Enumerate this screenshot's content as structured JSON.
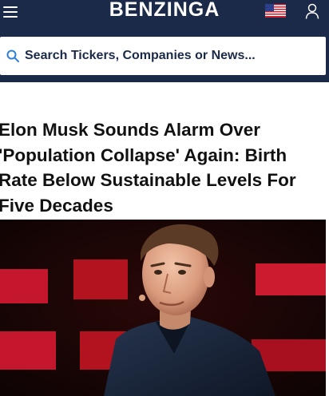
{
  "header": {
    "logo_text": "BENZINGA",
    "menu_icon": "hamburger-menu-icon",
    "flag_icon": "us-flag-icon",
    "user_icon": "user-account-icon",
    "background_color": "#1b2a48"
  },
  "search": {
    "icon": "search-icon",
    "placeholder": "Search Tickers, Companies or News...",
    "icon_color": "#2f7fd9"
  },
  "article": {
    "headline_lines": [
      "Elon Musk Sounds Alarm Over",
      "'Population Collapse' Again: Birth",
      "Rate Below Sustainable Levels For",
      "Five Decades"
    ],
    "image_description_icon": "article-hero-photo"
  }
}
